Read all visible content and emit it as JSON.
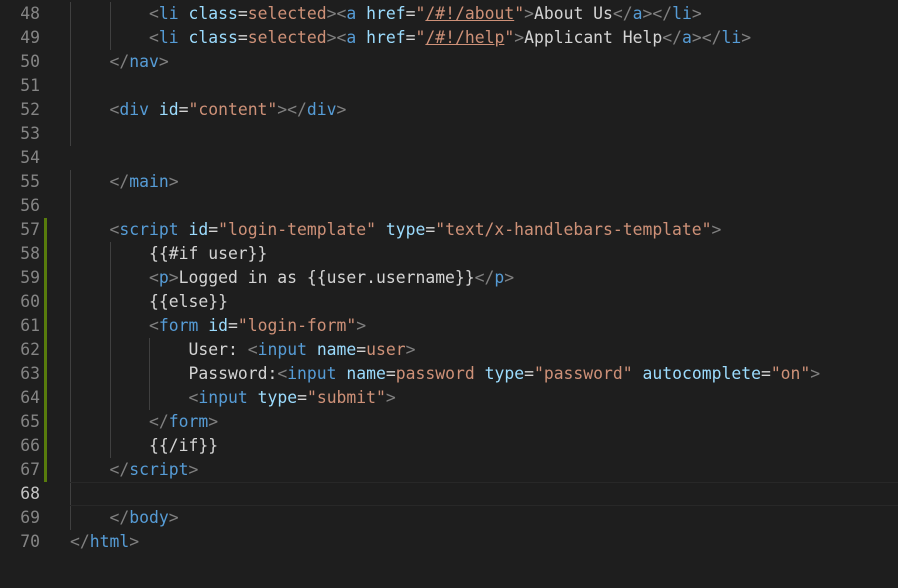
{
  "colors": {
    "background": "#1e1e1e",
    "line_number": "#858585",
    "tag": "#569cd6",
    "attribute": "#9cdcfe",
    "string": "#ce9178",
    "punctuation": "#808080",
    "text": "#d4d4d4",
    "modified_bar": "#587c0c"
  },
  "editor": {
    "active_line": 68,
    "modified_lines": [
      57,
      58,
      59,
      60,
      61,
      62,
      63,
      64,
      65,
      66,
      67
    ],
    "lines": [
      {
        "num": "48",
        "indent": 2,
        "tokens": [
          {
            "t": "<",
            "c": "punct"
          },
          {
            "t": "li",
            "c": "tag"
          },
          {
            "t": " ",
            "c": "text"
          },
          {
            "t": "class",
            "c": "attr"
          },
          {
            "t": "=",
            "c": "text"
          },
          {
            "t": "selected",
            "c": "str"
          },
          {
            "t": ">",
            "c": "punct"
          },
          {
            "t": "<",
            "c": "punct"
          },
          {
            "t": "a",
            "c": "tag"
          },
          {
            "t": " ",
            "c": "text"
          },
          {
            "t": "href",
            "c": "attr"
          },
          {
            "t": "=",
            "c": "text"
          },
          {
            "t": "\"",
            "c": "str"
          },
          {
            "t": "/#!/about",
            "c": "link"
          },
          {
            "t": "\"",
            "c": "str"
          },
          {
            "t": ">",
            "c": "punct"
          },
          {
            "t": "About Us",
            "c": "text"
          },
          {
            "t": "</",
            "c": "punct"
          },
          {
            "t": "a",
            "c": "tag"
          },
          {
            "t": ">",
            "c": "punct"
          },
          {
            "t": "</",
            "c": "punct"
          },
          {
            "t": "li",
            "c": "tag"
          },
          {
            "t": ">",
            "c": "punct"
          }
        ]
      },
      {
        "num": "49",
        "indent": 2,
        "tokens": [
          {
            "t": "<",
            "c": "punct"
          },
          {
            "t": "li",
            "c": "tag"
          },
          {
            "t": " ",
            "c": "text"
          },
          {
            "t": "class",
            "c": "attr"
          },
          {
            "t": "=",
            "c": "text"
          },
          {
            "t": "selected",
            "c": "str"
          },
          {
            "t": ">",
            "c": "punct"
          },
          {
            "t": "<",
            "c": "punct"
          },
          {
            "t": "a",
            "c": "tag"
          },
          {
            "t": " ",
            "c": "text"
          },
          {
            "t": "href",
            "c": "attr"
          },
          {
            "t": "=",
            "c": "text"
          },
          {
            "t": "\"",
            "c": "str"
          },
          {
            "t": "/#!/help",
            "c": "link"
          },
          {
            "t": "\"",
            "c": "str"
          },
          {
            "t": ">",
            "c": "punct"
          },
          {
            "t": "Applicant Help",
            "c": "text"
          },
          {
            "t": "</",
            "c": "punct"
          },
          {
            "t": "a",
            "c": "tag"
          },
          {
            "t": ">",
            "c": "punct"
          },
          {
            "t": "</",
            "c": "punct"
          },
          {
            "t": "li",
            "c": "tag"
          },
          {
            "t": ">",
            "c": "punct"
          }
        ]
      },
      {
        "num": "50",
        "indent": 1,
        "tokens": [
          {
            "t": "</",
            "c": "punct"
          },
          {
            "t": "nav",
            "c": "tag"
          },
          {
            "t": ">",
            "c": "punct"
          }
        ]
      },
      {
        "num": "51",
        "indent": 0,
        "tokens": []
      },
      {
        "num": "52",
        "indent": 1,
        "tokens": [
          {
            "t": "<",
            "c": "punct"
          },
          {
            "t": "div",
            "c": "tag"
          },
          {
            "t": " ",
            "c": "text"
          },
          {
            "t": "id",
            "c": "attr"
          },
          {
            "t": "=",
            "c": "text"
          },
          {
            "t": "\"content\"",
            "c": "str"
          },
          {
            "t": ">",
            "c": "punct"
          },
          {
            "t": "</",
            "c": "punct"
          },
          {
            "t": "div",
            "c": "tag"
          },
          {
            "t": ">",
            "c": "punct"
          }
        ]
      },
      {
        "num": "53",
        "indent": 0,
        "tokens": []
      },
      {
        "num": "54",
        "indent": 0,
        "tokens": []
      },
      {
        "num": "55",
        "indent": 1,
        "tokens": [
          {
            "t": "</",
            "c": "punct"
          },
          {
            "t": "main",
            "c": "tag"
          },
          {
            "t": ">",
            "c": "punct"
          }
        ]
      },
      {
        "num": "56",
        "indent": 0,
        "tokens": []
      },
      {
        "num": "57",
        "indent": 1,
        "tokens": [
          {
            "t": "<",
            "c": "punct"
          },
          {
            "t": "script",
            "c": "tag"
          },
          {
            "t": " ",
            "c": "text"
          },
          {
            "t": "id",
            "c": "attr"
          },
          {
            "t": "=",
            "c": "text"
          },
          {
            "t": "\"login-template\"",
            "c": "str"
          },
          {
            "t": " ",
            "c": "text"
          },
          {
            "t": "type",
            "c": "attr"
          },
          {
            "t": "=",
            "c": "text"
          },
          {
            "t": "\"text/x-handlebars-template\"",
            "c": "str"
          },
          {
            "t": ">",
            "c": "punct"
          }
        ]
      },
      {
        "num": "58",
        "indent": 2,
        "tokens": [
          {
            "t": "{{#if user}}",
            "c": "text"
          }
        ]
      },
      {
        "num": "59",
        "indent": 2,
        "tokens": [
          {
            "t": "<",
            "c": "punct"
          },
          {
            "t": "p",
            "c": "tag"
          },
          {
            "t": ">",
            "c": "punct"
          },
          {
            "t": "Logged in as {{user.username}}",
            "c": "text"
          },
          {
            "t": "</",
            "c": "punct"
          },
          {
            "t": "p",
            "c": "tag"
          },
          {
            "t": ">",
            "c": "punct"
          }
        ]
      },
      {
        "num": "60",
        "indent": 2,
        "tokens": [
          {
            "t": "{{else}}",
            "c": "text"
          }
        ]
      },
      {
        "num": "61",
        "indent": 2,
        "tokens": [
          {
            "t": "<",
            "c": "punct"
          },
          {
            "t": "form",
            "c": "tag"
          },
          {
            "t": " ",
            "c": "text"
          },
          {
            "t": "id",
            "c": "attr"
          },
          {
            "t": "=",
            "c": "text"
          },
          {
            "t": "\"login-form\"",
            "c": "str"
          },
          {
            "t": ">",
            "c": "punct"
          }
        ]
      },
      {
        "num": "62",
        "indent": 3,
        "tokens": [
          {
            "t": "User: ",
            "c": "text"
          },
          {
            "t": "<",
            "c": "punct"
          },
          {
            "t": "input",
            "c": "tag"
          },
          {
            "t": " ",
            "c": "text"
          },
          {
            "t": "name",
            "c": "attr"
          },
          {
            "t": "=",
            "c": "text"
          },
          {
            "t": "user",
            "c": "str"
          },
          {
            "t": ">",
            "c": "punct"
          }
        ]
      },
      {
        "num": "63",
        "indent": 3,
        "tokens": [
          {
            "t": "Password:",
            "c": "text"
          },
          {
            "t": "<",
            "c": "punct"
          },
          {
            "t": "input",
            "c": "tag"
          },
          {
            "t": " ",
            "c": "text"
          },
          {
            "t": "name",
            "c": "attr"
          },
          {
            "t": "=",
            "c": "text"
          },
          {
            "t": "password",
            "c": "str"
          },
          {
            "t": " ",
            "c": "text"
          },
          {
            "t": "type",
            "c": "attr"
          },
          {
            "t": "=",
            "c": "text"
          },
          {
            "t": "\"password\"",
            "c": "str"
          },
          {
            "t": " ",
            "c": "text"
          },
          {
            "t": "autocomplete",
            "c": "attr"
          },
          {
            "t": "=",
            "c": "text"
          },
          {
            "t": "\"on\"",
            "c": "str"
          },
          {
            "t": ">",
            "c": "punct"
          }
        ]
      },
      {
        "num": "64",
        "indent": 3,
        "tokens": [
          {
            "t": "<",
            "c": "punct"
          },
          {
            "t": "input",
            "c": "tag"
          },
          {
            "t": " ",
            "c": "text"
          },
          {
            "t": "type",
            "c": "attr"
          },
          {
            "t": "=",
            "c": "text"
          },
          {
            "t": "\"submit\"",
            "c": "str"
          },
          {
            "t": ">",
            "c": "punct"
          }
        ]
      },
      {
        "num": "65",
        "indent": 2,
        "tokens": [
          {
            "t": "</",
            "c": "punct"
          },
          {
            "t": "form",
            "c": "tag"
          },
          {
            "t": ">",
            "c": "punct"
          }
        ]
      },
      {
        "num": "66",
        "indent": 2,
        "tokens": [
          {
            "t": "{{/if}}",
            "c": "text"
          }
        ]
      },
      {
        "num": "67",
        "indent": 1,
        "tokens": [
          {
            "t": "</",
            "c": "punct"
          },
          {
            "t": "script",
            "c": "tag"
          },
          {
            "t": ">",
            "c": "punct"
          }
        ]
      },
      {
        "num": "68",
        "indent": 0,
        "tokens": []
      },
      {
        "num": "69",
        "indent": 1,
        "tokens": [
          {
            "t": "</",
            "c": "punct"
          },
          {
            "t": "body",
            "c": "tag"
          },
          {
            "t": ">",
            "c": "punct"
          }
        ]
      },
      {
        "num": "70",
        "indent": 0,
        "tokens": [
          {
            "t": "</",
            "c": "punct"
          },
          {
            "t": "html",
            "c": "tag"
          },
          {
            "t": ">",
            "c": "punct"
          }
        ]
      }
    ]
  }
}
